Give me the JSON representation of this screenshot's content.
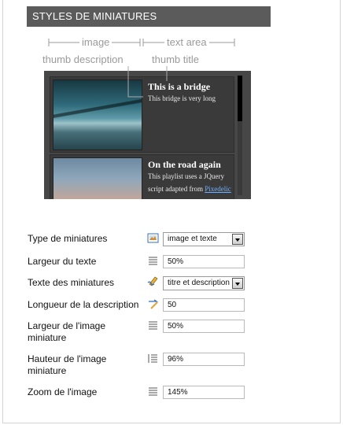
{
  "section": {
    "title": "STYLES DE MINIATURES"
  },
  "diagram": {
    "image_label": "image",
    "text_area_label": "text area",
    "thumb_description_label": "thumb description",
    "thumb_title_label": "thumb title"
  },
  "preview": {
    "items": [
      {
        "title": "This is a bridge",
        "description": "This bridge is very long"
      },
      {
        "title": "On the road again",
        "description": "This playlist uses a JQuery script adapted from",
        "link": "Pixedelic"
      }
    ]
  },
  "form": {
    "thumb_type": {
      "label": "Type de miniatures",
      "icon": "thumbnail-type-icon",
      "value": "image et texte"
    },
    "text_width": {
      "label": "Largeur du texte",
      "icon": "width-lines-icon",
      "value": "50%"
    },
    "thumb_text": {
      "label": "Texte des miniatures",
      "icon": "text-edit-icon",
      "value": "titre et description"
    },
    "desc_length": {
      "label": "Longueur de la description",
      "icon": "length-arrow-icon",
      "value": "50"
    },
    "image_width": {
      "label": "Largeur de l'image miniature",
      "icon": "width-lines-icon",
      "value": "50%"
    },
    "image_height": {
      "label": "Hauteur de l'image miniature",
      "icon": "height-lines-icon",
      "value": "96%"
    },
    "image_zoom": {
      "label": "Zoom de l'image",
      "icon": "zoom-lines-icon",
      "value": "145%"
    }
  }
}
